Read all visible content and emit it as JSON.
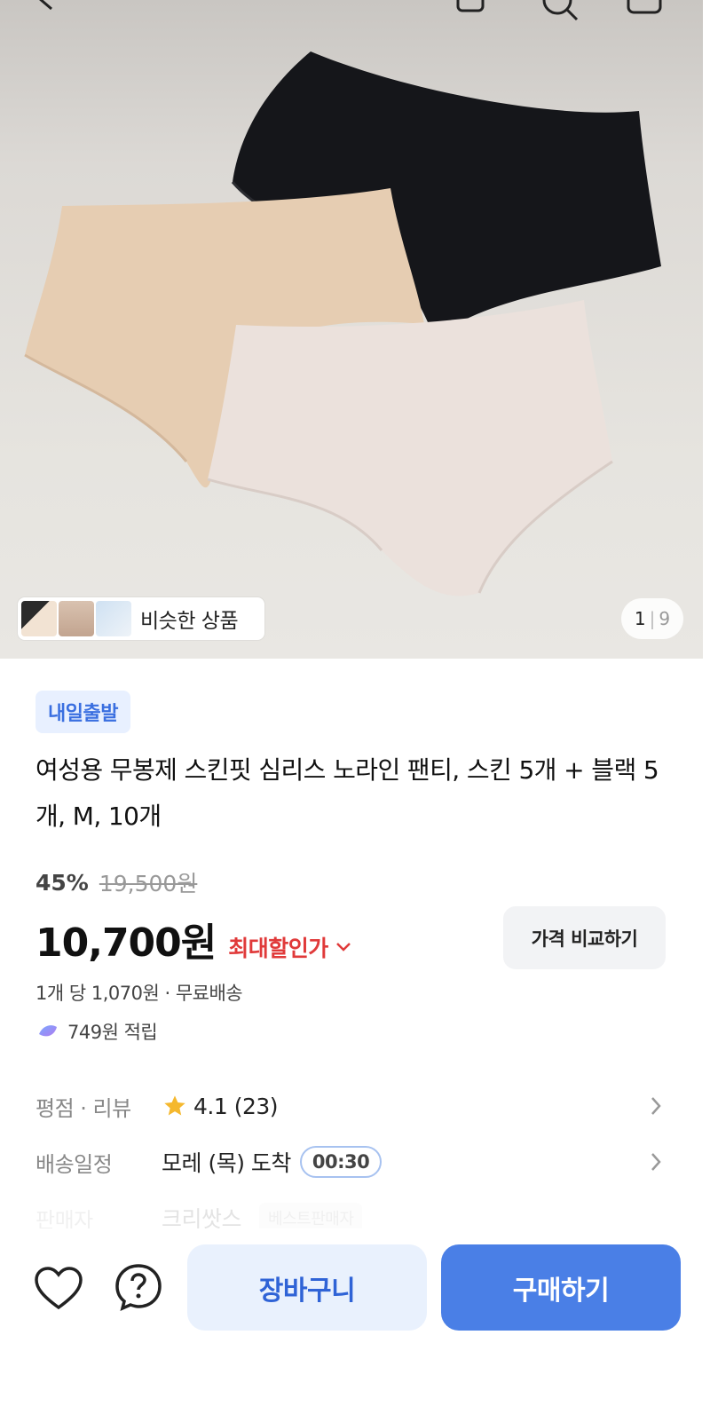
{
  "gallery": {
    "similar_label": "비슷한 상품",
    "page_current": "1",
    "page_total": "9"
  },
  "product": {
    "badge": "내일출발",
    "title": "여성용 무봉제 스킨핏 심리스 노라인 팬티, 스킨 5개 + 블랙 5개, M, 10개",
    "discount_percent": "45%",
    "original_price": "19,500원",
    "price": "10,700원",
    "max_discount_label": "최대할인가",
    "compare_label": "가격 비교하기",
    "unit_info": "1개 당 1,070원 · 무료배송",
    "points": "749원 적립"
  },
  "info": {
    "rating_label": "평점 · 리뷰",
    "rating_value": "4.1 (23)",
    "delivery_label": "배송일정",
    "delivery_value": "모레 (목) 도착",
    "delivery_timer": "00:30",
    "seller_label": "판매자",
    "seller_value": "크리쌋스",
    "seller_tag": "베스트판매자"
  },
  "actions": {
    "cart": "장바구니",
    "buy": "구매하기"
  },
  "colors": {
    "accent": "#4a7fe6",
    "sale_red": "#e03a3a",
    "badge_bg": "#e8f0ff",
    "star": "#f5b82e"
  }
}
